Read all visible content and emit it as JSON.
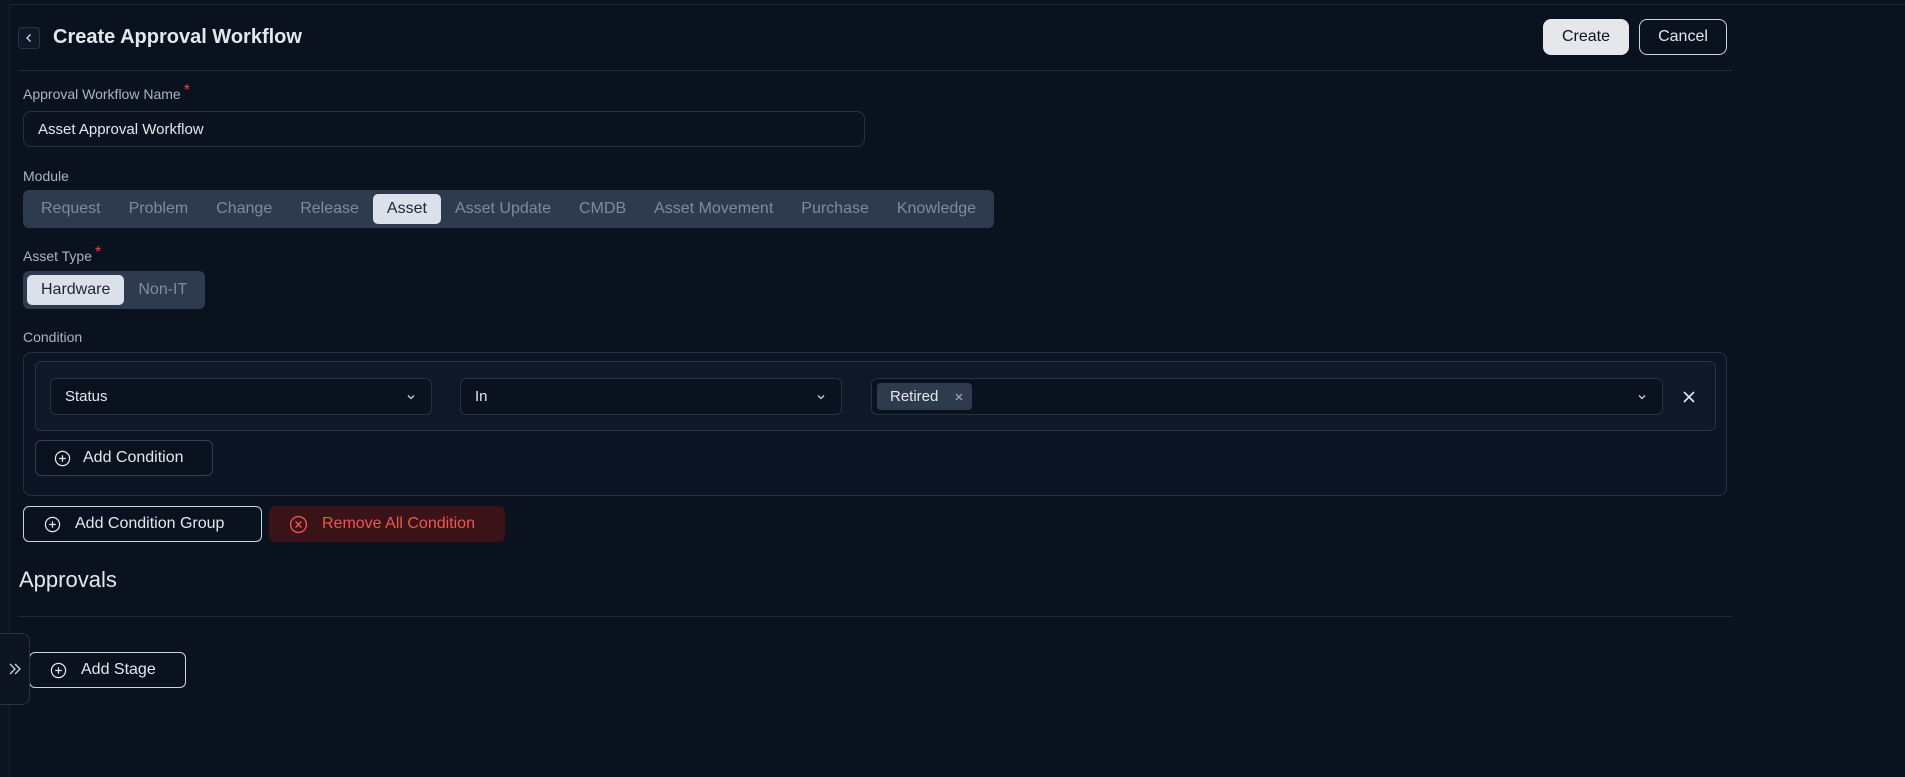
{
  "header": {
    "title": "Create Approval Workflow",
    "create_label": "Create",
    "cancel_label": "Cancel"
  },
  "form": {
    "name_label": "Approval Workflow Name",
    "required_mark": "*",
    "name_value": "Asset Approval Workflow",
    "module_label": "Module",
    "modules": [
      "Request",
      "Problem",
      "Change",
      "Release",
      "Asset",
      "Asset Update",
      "CMDB",
      "Asset Movement",
      "Purchase",
      "Knowledge"
    ],
    "module_selected": "Asset",
    "asset_type_label": "Asset Type",
    "asset_types": [
      "Hardware",
      "Non-IT"
    ],
    "asset_type_selected": "Hardware"
  },
  "condition": {
    "label": "Condition",
    "field": "Status",
    "operator": "In",
    "values": [
      "Retired"
    ],
    "add_condition_label": "Add Condition",
    "add_group_label": "Add Condition Group",
    "remove_all_label": "Remove All Condition"
  },
  "approvals": {
    "title": "Approvals",
    "add_stage_label": "Add Stage"
  },
  "icons": {
    "back": "chevron-left-icon",
    "dropdown": "chevron-down-icon",
    "remove_tag": "x-icon",
    "remove_row": "close-icon",
    "add": "plus-circle-icon",
    "remove_all": "x-circle-icon",
    "sidebar": "double-chevron-right-icon"
  },
  "colors": {
    "background": "#0a1220",
    "accent_light": "#e5e7eb",
    "danger": "#f0564e",
    "danger_bg": "#3a1318",
    "required": "#ef4444"
  }
}
